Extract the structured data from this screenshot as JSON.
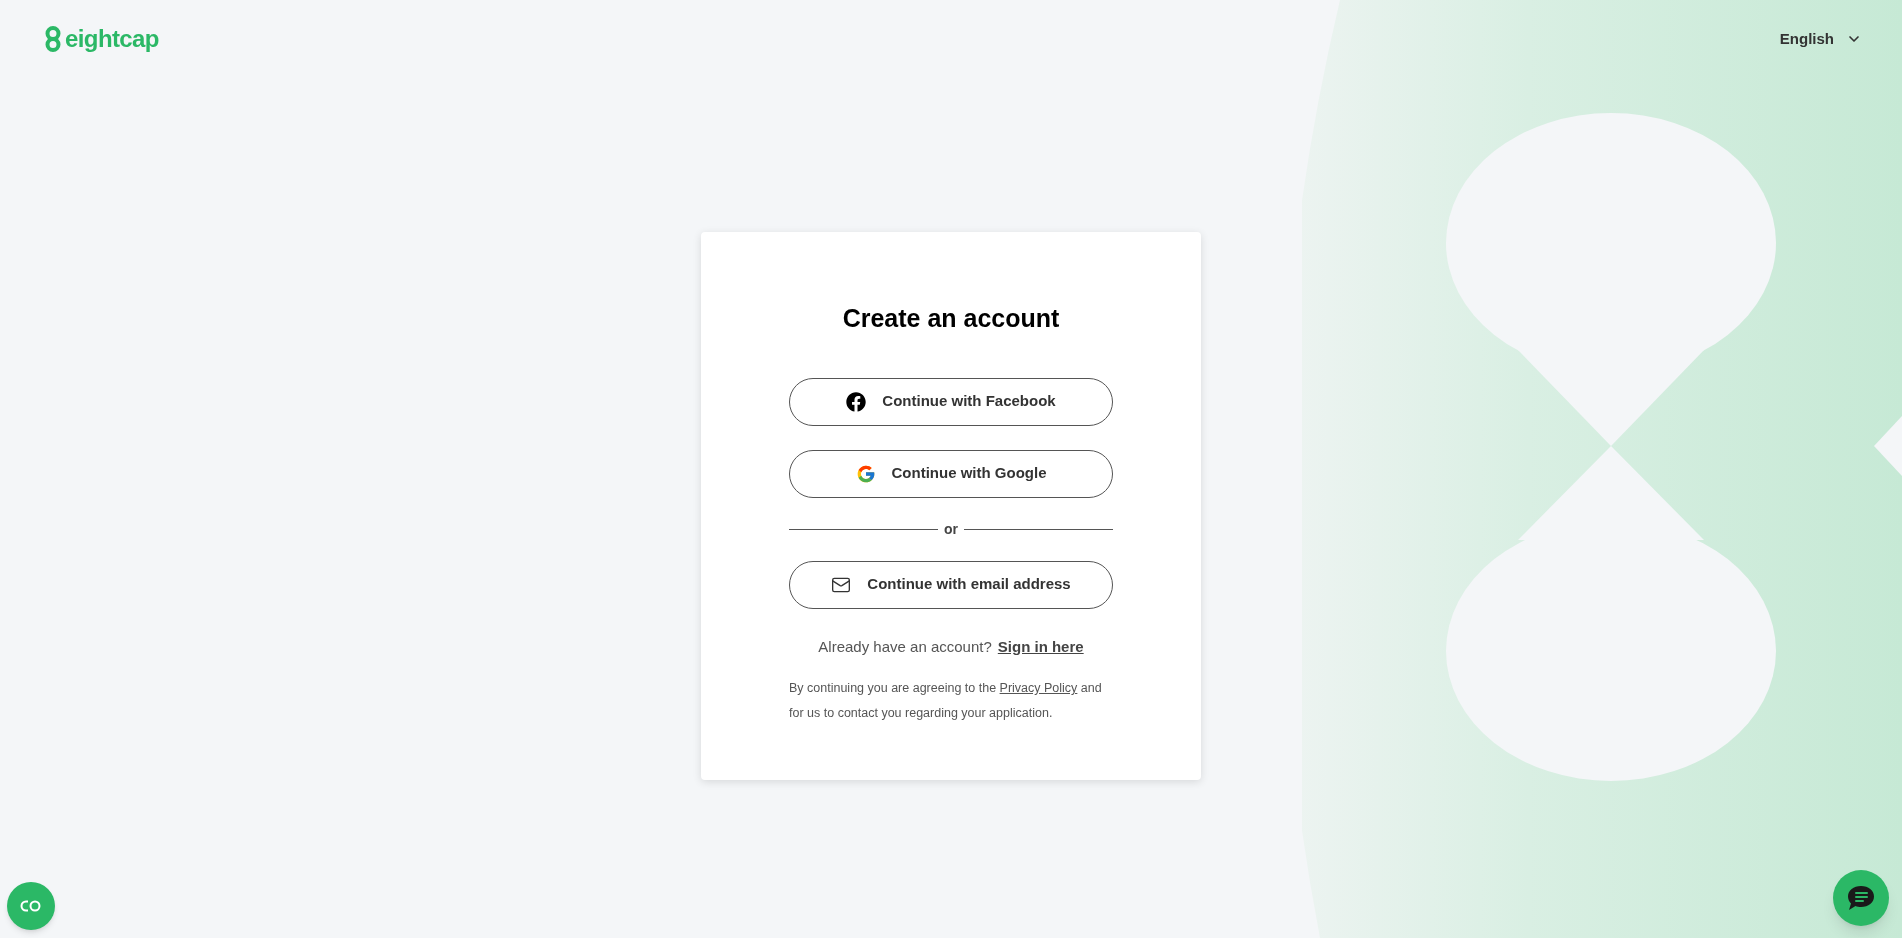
{
  "header": {
    "logo_text": "eightcap",
    "language": "English"
  },
  "card": {
    "title": "Create an account",
    "buttons": [
      {
        "kind": "facebook",
        "label": "Continue with Facebook"
      },
      {
        "kind": "google",
        "label": "Continue with Google"
      },
      {
        "kind": "divider",
        "label": "or"
      },
      {
        "kind": "email",
        "label": "Continue with email address"
      }
    ],
    "signin": {
      "prompt": "Already have an account?",
      "link": "Sign in here"
    },
    "consent": {
      "before": "By continuing you are agreeing to the",
      "link": "Privacy Policy",
      "after": "and for us to contact you regarding your application."
    }
  }
}
